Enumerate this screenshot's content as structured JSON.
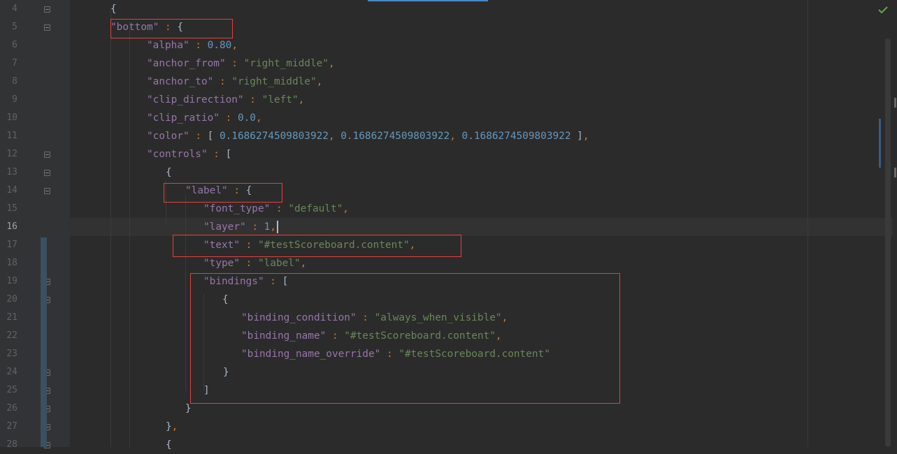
{
  "editor": {
    "status_icon": "check-icon",
    "current_line": 16,
    "colors": {
      "background": "#2b2b2b",
      "gutter": "#313335",
      "key": "#9876aa",
      "string": "#6a8759",
      "number": "#6897bb",
      "punct": "#cc7832",
      "highlight_box": "#e14141"
    }
  },
  "lines": [
    {
      "num": "4",
      "tokens": [
        {
          "t": "{",
          "c": "t"
        }
      ]
    },
    {
      "num": "5",
      "tokens": [
        {
          "t": "\"bottom\"",
          "c": "k"
        },
        {
          "t": " : ",
          "c": "p"
        },
        {
          "t": "{",
          "c": "t"
        }
      ]
    },
    {
      "num": "6",
      "tokens": [
        {
          "t": "\"alpha\"",
          "c": "k"
        },
        {
          "t": " : ",
          "c": "p"
        },
        {
          "t": "0.80",
          "c": "n"
        },
        {
          "t": ",",
          "c": "p"
        }
      ]
    },
    {
      "num": "7",
      "tokens": [
        {
          "t": "\"anchor_from\"",
          "c": "k"
        },
        {
          "t": " : ",
          "c": "p"
        },
        {
          "t": "\"right_middle\"",
          "c": "s"
        },
        {
          "t": ",",
          "c": "p"
        }
      ]
    },
    {
      "num": "8",
      "tokens": [
        {
          "t": "\"anchor_to\"",
          "c": "k"
        },
        {
          "t": " : ",
          "c": "p"
        },
        {
          "t": "\"right_middle\"",
          "c": "s"
        },
        {
          "t": ",",
          "c": "p"
        }
      ]
    },
    {
      "num": "9",
      "tokens": [
        {
          "t": "\"clip_direction\"",
          "c": "k"
        },
        {
          "t": " : ",
          "c": "p"
        },
        {
          "t": "\"left\"",
          "c": "s"
        },
        {
          "t": ",",
          "c": "p"
        }
      ]
    },
    {
      "num": "10",
      "tokens": [
        {
          "t": "\"clip_ratio\"",
          "c": "k"
        },
        {
          "t": " : ",
          "c": "p"
        },
        {
          "t": "0.0",
          "c": "n"
        },
        {
          "t": ",",
          "c": "p"
        }
      ]
    },
    {
      "num": "11",
      "tokens": [
        {
          "t": "\"color\"",
          "c": "k"
        },
        {
          "t": " : ",
          "c": "p"
        },
        {
          "t": "[ ",
          "c": "t"
        },
        {
          "t": "0.1686274509803922",
          "c": "n"
        },
        {
          "t": ", ",
          "c": "p"
        },
        {
          "t": "0.1686274509803922",
          "c": "n"
        },
        {
          "t": ", ",
          "c": "p"
        },
        {
          "t": "0.1686274509803922",
          "c": "n"
        },
        {
          "t": " ]",
          "c": "t"
        },
        {
          "t": ",",
          "c": "p"
        }
      ]
    },
    {
      "num": "12",
      "tokens": [
        {
          "t": "\"controls\"",
          "c": "k"
        },
        {
          "t": " : ",
          "c": "p"
        },
        {
          "t": "[",
          "c": "t"
        }
      ]
    },
    {
      "num": "13",
      "tokens": [
        {
          "t": "{",
          "c": "t"
        }
      ]
    },
    {
      "num": "14",
      "tokens": [
        {
          "t": "\"label\"",
          "c": "k"
        },
        {
          "t": " : ",
          "c": "p"
        },
        {
          "t": "{",
          "c": "t"
        }
      ]
    },
    {
      "num": "15",
      "tokens": [
        {
          "t": "\"font_type\"",
          "c": "k"
        },
        {
          "t": " : ",
          "c": "p"
        },
        {
          "t": "\"default\"",
          "c": "s"
        },
        {
          "t": ",",
          "c": "p"
        }
      ]
    },
    {
      "num": "16",
      "tokens": [
        {
          "t": "\"layer\"",
          "c": "k"
        },
        {
          "t": " : ",
          "c": "p"
        },
        {
          "t": "1",
          "c": "n"
        },
        {
          "t": ",",
          "c": "p"
        }
      ]
    },
    {
      "num": "17",
      "tokens": [
        {
          "t": "\"text\"",
          "c": "k"
        },
        {
          "t": " : ",
          "c": "p"
        },
        {
          "t": "\"#testScoreboard.content\"",
          "c": "s"
        },
        {
          "t": ",",
          "c": "p"
        }
      ]
    },
    {
      "num": "18",
      "tokens": [
        {
          "t": "\"type\"",
          "c": "k"
        },
        {
          "t": " : ",
          "c": "p"
        },
        {
          "t": "\"label\"",
          "c": "s"
        },
        {
          "t": ",",
          "c": "p"
        }
      ]
    },
    {
      "num": "19",
      "tokens": [
        {
          "t": "\"bindings\"",
          "c": "k"
        },
        {
          "t": " : ",
          "c": "p"
        },
        {
          "t": "[",
          "c": "t"
        }
      ]
    },
    {
      "num": "20",
      "tokens": [
        {
          "t": "{",
          "c": "t"
        }
      ]
    },
    {
      "num": "21",
      "tokens": [
        {
          "t": "\"binding_condition\"",
          "c": "k"
        },
        {
          "t": " : ",
          "c": "p"
        },
        {
          "t": "\"always_when_visible\"",
          "c": "s"
        },
        {
          "t": ",",
          "c": "p"
        }
      ]
    },
    {
      "num": "22",
      "tokens": [
        {
          "t": "\"binding_name\"",
          "c": "k"
        },
        {
          "t": " : ",
          "c": "p"
        },
        {
          "t": "\"#testScoreboard.content\"",
          "c": "s"
        },
        {
          "t": ",",
          "c": "p"
        }
      ]
    },
    {
      "num": "23",
      "tokens": [
        {
          "t": "\"binding_name_override\"",
          "c": "k"
        },
        {
          "t": " : ",
          "c": "p"
        },
        {
          "t": "\"#testScoreboard.content\"",
          "c": "s"
        }
      ]
    },
    {
      "num": "24",
      "tokens": [
        {
          "t": "}",
          "c": "t"
        }
      ]
    },
    {
      "num": "25",
      "tokens": [
        {
          "t": "]",
          "c": "t"
        }
      ]
    },
    {
      "num": "26",
      "tokens": [
        {
          "t": "}",
          "c": "t"
        }
      ]
    },
    {
      "num": "27",
      "tokens": [
        {
          "t": "}",
          "c": "t"
        },
        {
          "t": ",",
          "c": "p"
        }
      ]
    },
    {
      "num": "28",
      "tokens": [
        {
          "t": "{",
          "c": "t"
        }
      ]
    }
  ]
}
